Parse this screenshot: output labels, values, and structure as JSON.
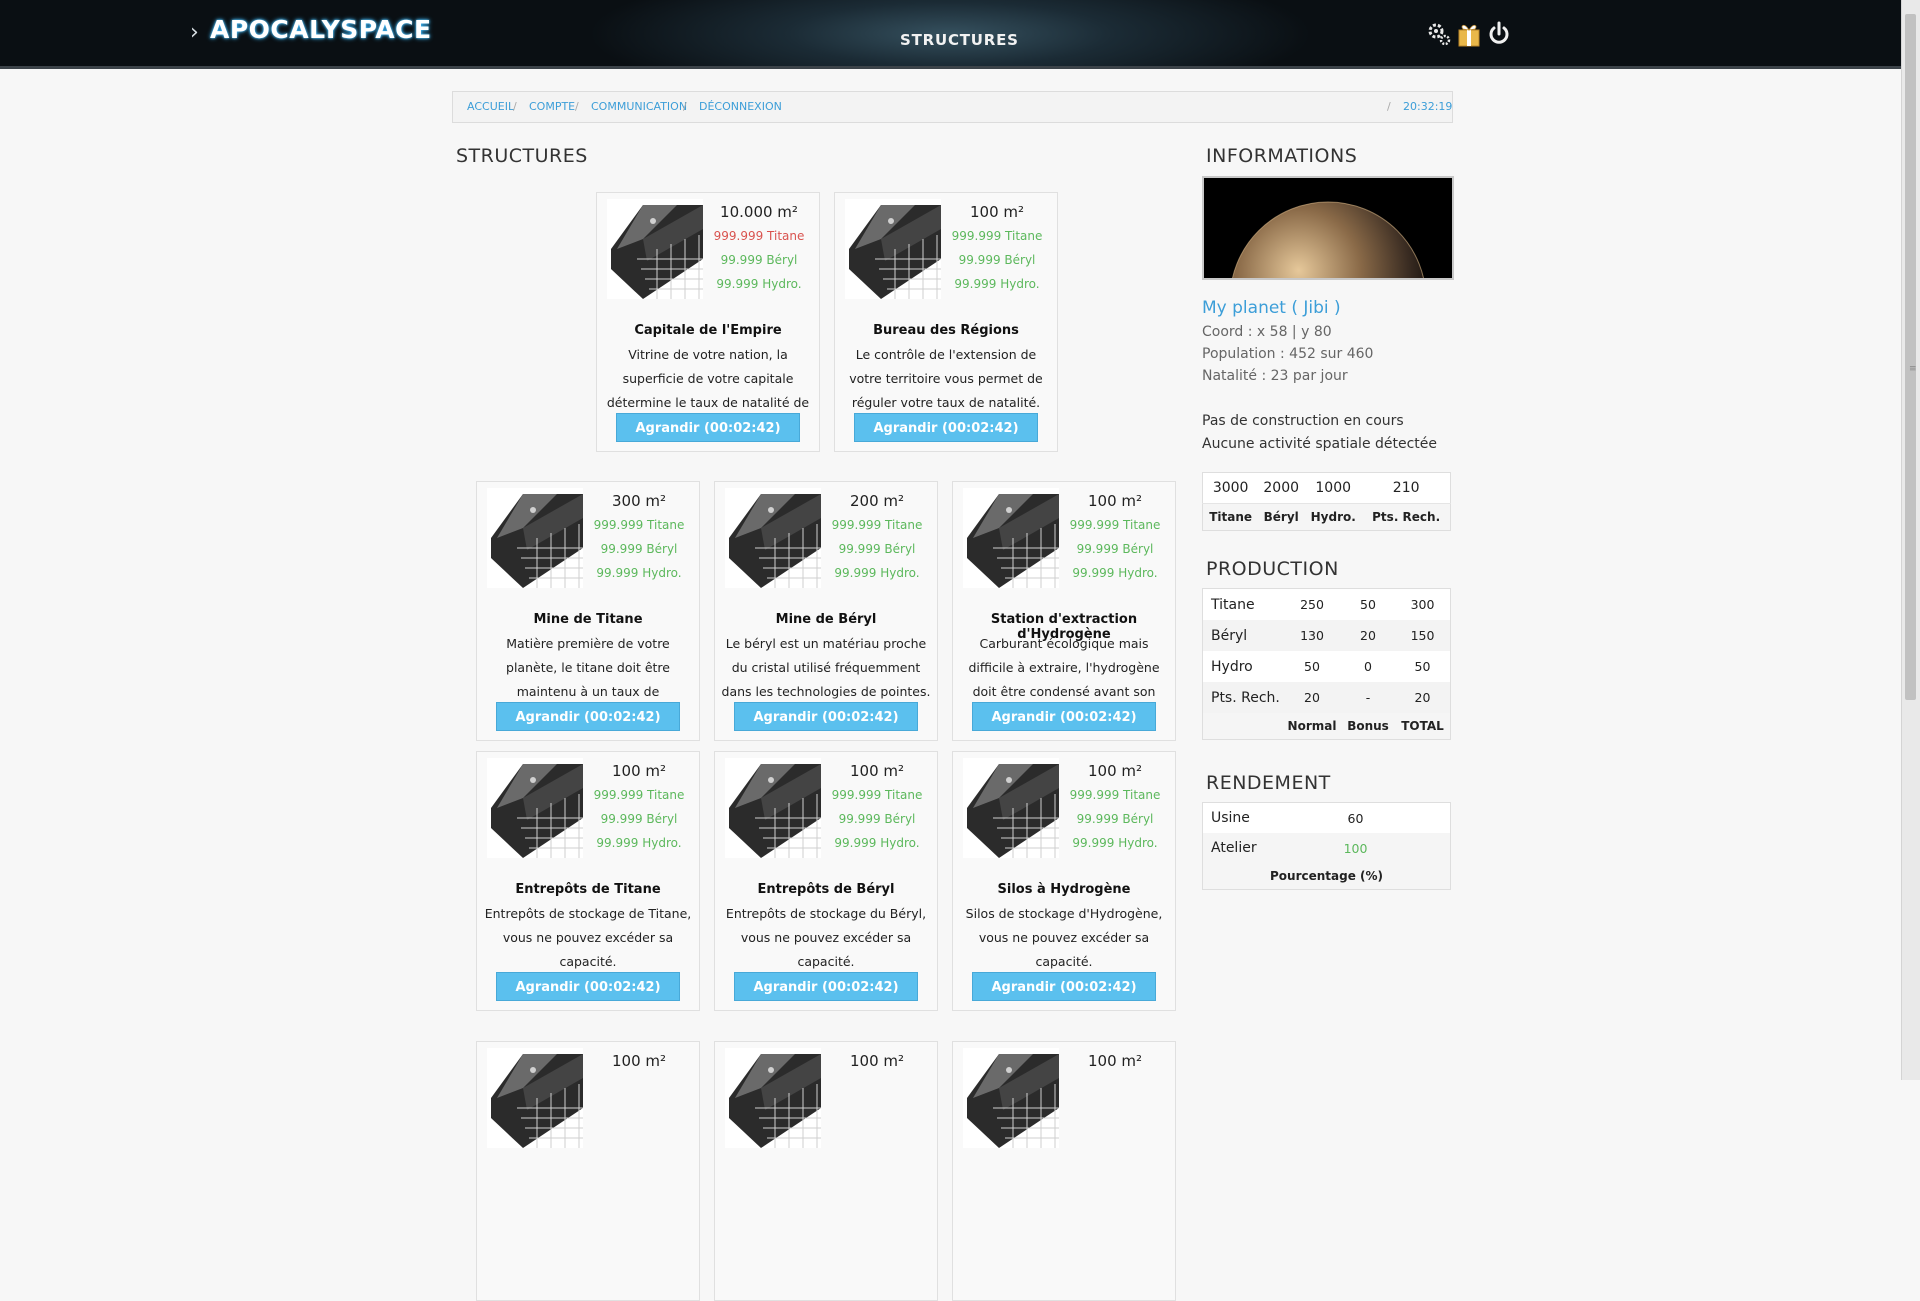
{
  "header": {
    "logo": "APOCALYSPACE",
    "title": "STRUCTURES"
  },
  "breadcrumb": {
    "items": [
      "ACCUEIL",
      "COMPTE",
      "COMMUNICATION",
      "DÉCONNEXION"
    ],
    "separator": "/",
    "time": "20:32:19"
  },
  "main": {
    "title": "STRUCTURES",
    "cards": [
      {
        "name": "Capitale de l'Empire",
        "area": "10.000 m²",
        "titane": "999.999 Titane",
        "beryl": "99.999 Béryl",
        "hydro": "99.999 Hydro.",
        "titane_status": "insufficient",
        "description": "Vitrine de votre nation, la superficie de votre capitale détermine le taux de natalité de votre empire.",
        "button": "Agrandir (00:02:42)"
      },
      {
        "name": "Bureau des Régions",
        "area": "100 m²",
        "titane": "999.999 Titane",
        "beryl": "99.999 Béryl",
        "hydro": "99.999 Hydro.",
        "titane_status": "ok",
        "description": "Le contrôle de l'extension de votre territoire vous permet de réguler votre taux de natalité.",
        "button": "Agrandir (00:02:42)"
      },
      {
        "name": "Mine de Titane",
        "area": "300 m²",
        "titane": "999.999 Titane",
        "beryl": "99.999 Béryl",
        "hydro": "99.999 Hydro.",
        "titane_status": "ok",
        "description": "Matière première de votre planète, le titane doit être maintenu à un taux de rendement elevé.",
        "button": "Agrandir (00:02:42)"
      },
      {
        "name": "Mine de Béryl",
        "area": "200 m²",
        "titane": "999.999 Titane",
        "beryl": "99.999 Béryl",
        "hydro": "99.999 Hydro.",
        "titane_status": "ok",
        "description": "Le béryl est un matériau proche du cristal utilisé fréquemment dans les technologies de pointes.",
        "button": "Agrandir (00:02:42)"
      },
      {
        "name": "Station d'extraction d'Hydrogène",
        "area": "100 m²",
        "titane": "999.999 Titane",
        "beryl": "99.999 Béryl",
        "hydro": "99.999 Hydro.",
        "titane_status": "ok",
        "description": "Carburant écologique mais difficile à extraire, l'hydrogène doit être condensé avant son utilisation.",
        "button": "Agrandir (00:02:42)"
      },
      {
        "name": "Entrepôts de Titane",
        "area": "100 m²",
        "titane": "999.999 Titane",
        "beryl": "99.999 Béryl",
        "hydro": "99.999 Hydro.",
        "titane_status": "ok",
        "description": "Entrepôts de stockage de Titane, vous ne pouvez excéder sa capacité.",
        "button": "Agrandir (00:02:42)"
      },
      {
        "name": "Entrepôts de Béryl",
        "area": "100 m²",
        "titane": "999.999 Titane",
        "beryl": "99.999 Béryl",
        "hydro": "99.999 Hydro.",
        "titane_status": "ok",
        "description": "Entrepôts de stockage du Béryl, vous ne pouvez excéder sa capacité.",
        "button": "Agrandir (00:02:42)"
      },
      {
        "name": "Silos à Hydrogène",
        "area": "100 m²",
        "titane": "999.999 Titane",
        "beryl": "99.999 Béryl",
        "hydro": "99.999 Hydro.",
        "titane_status": "ok",
        "description": "Silos de stockage d'Hydrogène, vous ne pouvez excéder sa capacité.",
        "button": "Agrandir (00:02:42)"
      },
      {
        "name": "",
        "area": "100 m²",
        "titane": "",
        "beryl": "",
        "hydro": "",
        "titane_status": "ok",
        "description": "",
        "button": ""
      },
      {
        "name": "",
        "area": "100 m²",
        "titane": "",
        "beryl": "",
        "hydro": "",
        "titane_status": "ok",
        "description": "",
        "button": ""
      },
      {
        "name": "",
        "area": "100 m²",
        "titane": "",
        "beryl": "",
        "hydro": "",
        "titane_status": "ok",
        "description": "",
        "button": ""
      }
    ]
  },
  "sidebar": {
    "info_title": "INFORMATIONS",
    "planet_name": "My planet ( Jibi )",
    "coord": "Coord : x 58 | y 80",
    "population": "Population : 452 sur 460",
    "natalite": "Natalité : 23 par jour",
    "construction": "Pas de construction en cours",
    "activity": "Aucune activité spatiale détectée",
    "stock": {
      "values": [
        "3000",
        "2000",
        "1000",
        "210"
      ],
      "labels": [
        "Titane",
        "Béryl",
        "Hydro.",
        "Pts. Rech."
      ]
    },
    "production": {
      "title": "PRODUCTION",
      "rows": [
        {
          "label": "Titane",
          "normal": "250",
          "bonus": "50",
          "total": "300"
        },
        {
          "label": "Béryl",
          "normal": "130",
          "bonus": "20",
          "total": "150"
        },
        {
          "label": "Hydro",
          "normal": "50",
          "bonus": "0",
          "total": "50"
        },
        {
          "label": "Pts. Rech.",
          "normal": "20",
          "bonus": "-",
          "total": "20"
        }
      ],
      "footer": [
        "Normal",
        "Bonus",
        "TOTAL"
      ]
    },
    "rendement": {
      "title": "RENDEMENT",
      "rows": [
        {
          "label": "Usine",
          "value": "60",
          "color": "#222222"
        },
        {
          "label": "Atelier",
          "value": "100",
          "color": "#5cb85c"
        }
      ],
      "footer": "Pourcentage (%)"
    }
  },
  "colors": {
    "accent": "#5bc0ee",
    "link": "#3c9ed8",
    "ok": "#5cb85c",
    "insufficient": "#d9534f"
  },
  "icons": [
    "settings-icon",
    "gift-icon",
    "power-icon"
  ]
}
